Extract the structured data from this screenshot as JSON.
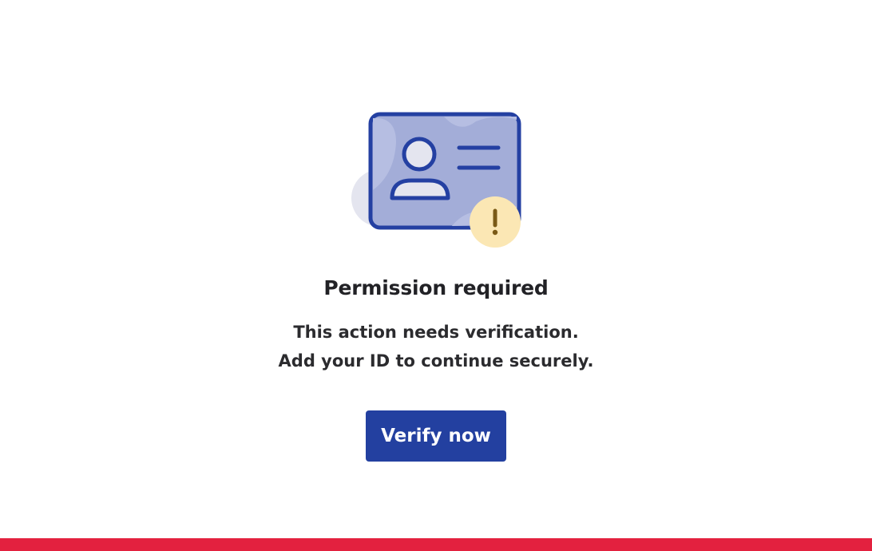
{
  "dialog": {
    "title": "Permission required",
    "message_line1": "This action needs verification.",
    "message_line2": "Add your ID to continue securely.",
    "verify_button_label": "Verify now",
    "illustration_icon": "id-card-warning-icon",
    "warning_symbol": "!"
  },
  "colors": {
    "brand_blue": "#2340a0",
    "card_outline": "#2440a2",
    "card_fill": "#a3add8",
    "blob_fill": "#e4e5ef",
    "warning_fill": "#fbe7b4",
    "warning_mark": "#7a5a16",
    "footer_red": "#e3213f"
  }
}
